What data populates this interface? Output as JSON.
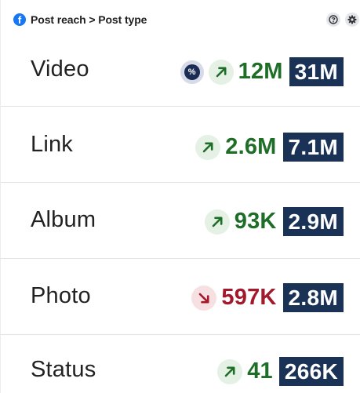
{
  "header": {
    "brand_letter": "f",
    "title": "Post reach > Post type",
    "help_icon": "help-icon",
    "settings_icon": "gear-icon"
  },
  "colors": {
    "up": "#1e6e27",
    "down": "#a3182a",
    "total_bg": "#1b3257",
    "brand": "#1877f2"
  },
  "rows": [
    {
      "label": "Video",
      "percent_symbol": "%",
      "trend": "up",
      "change": "12M",
      "total": "31M"
    },
    {
      "label": "Link",
      "trend": "up",
      "change": "2.6M",
      "total": "7.1M"
    },
    {
      "label": "Album",
      "trend": "up",
      "change": "93K",
      "total": "2.9M"
    },
    {
      "label": "Photo",
      "trend": "down",
      "change": "597K",
      "total": "2.8M"
    },
    {
      "label": "Status",
      "trend": "up",
      "change": "41",
      "total": "266K"
    }
  ]
}
